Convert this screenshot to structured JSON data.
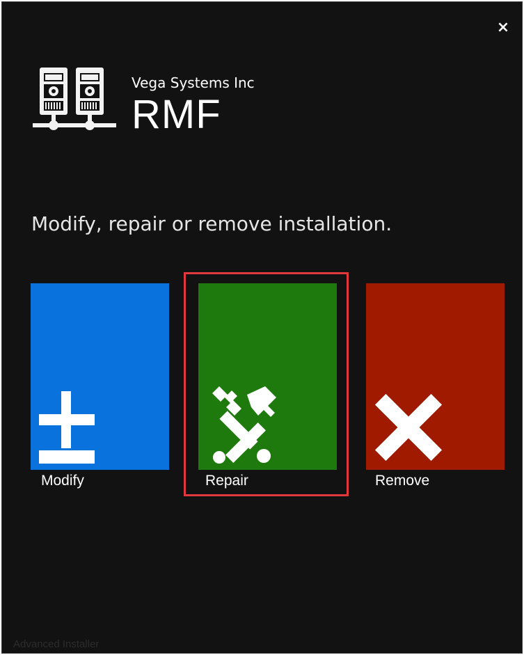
{
  "window": {
    "close_label": "×"
  },
  "header": {
    "vendor": "Vega Systems Inc",
    "product": "RMF"
  },
  "main": {
    "heading": "Modify, repair or remove installation.",
    "options": [
      {
        "label": "Modify",
        "color": "#0a72dc",
        "icon": "plus-minus-icon"
      },
      {
        "label": "Repair",
        "color": "#1f7a0e",
        "icon": "repair-tools-icon"
      },
      {
        "label": "Remove",
        "color": "#a01a00",
        "icon": "x-icon"
      }
    ],
    "highlight_color": "#e0383c"
  },
  "footer": {
    "text": "Advanced Installer"
  }
}
